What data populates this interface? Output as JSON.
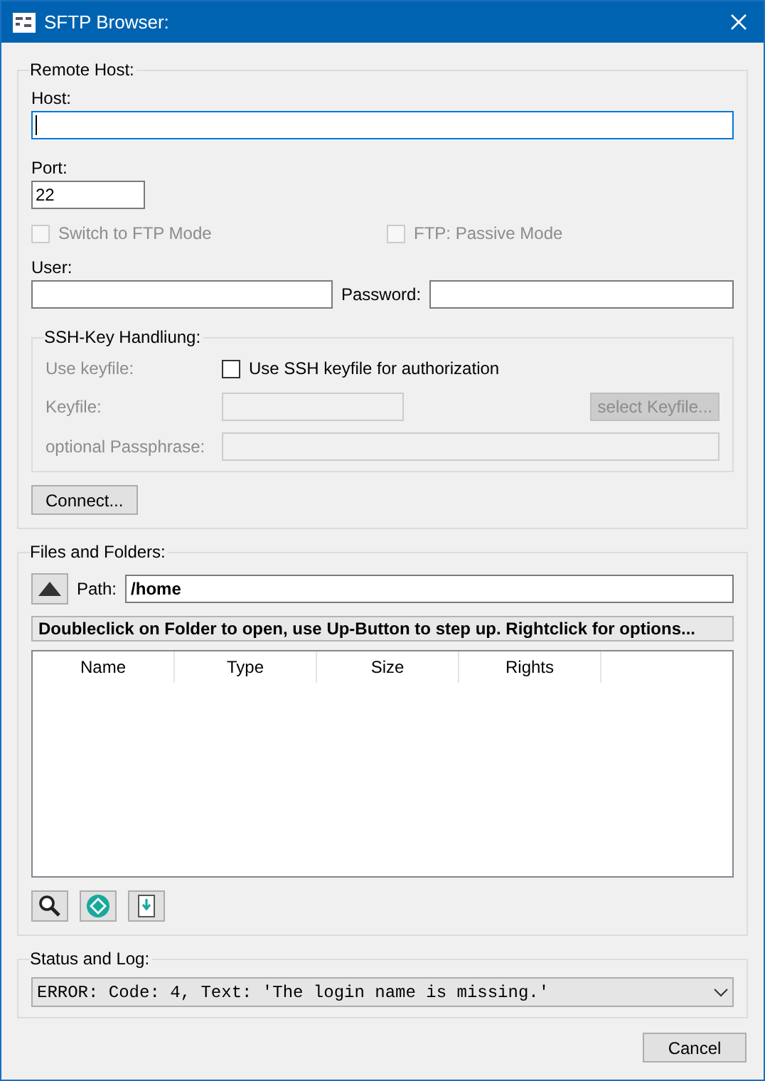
{
  "window": {
    "title": "SFTP Browser:"
  },
  "remote_host": {
    "title": "Remote Host:",
    "host": {
      "label": "Host:",
      "focused": true
    },
    "port": {
      "label": "Port:",
      "value": "22"
    },
    "ftp_mode": {
      "label": "Switch to FTP Mode",
      "checked": false,
      "disabled": true
    },
    "passive_mode": {
      "label": "FTP: Passive Mode",
      "checked": false,
      "disabled": true
    },
    "user": {
      "label": "User:"
    },
    "password": {
      "label": "Password:"
    },
    "ssh": {
      "title": "SSH-Key Handliung:",
      "use_keyfile_label": "Use keyfile:",
      "use_keyfile": {
        "label": "Use SSH keyfile for authorization",
        "checked": false
      },
      "keyfile_label": "Keyfile:",
      "select_button": "select Keyfile...",
      "passphrase_label": "optional Passphrase:",
      "disabled": true
    },
    "connect_button": "Connect..."
  },
  "files": {
    "title": "Files and Folders:",
    "path_label": "Path:",
    "path": "/home",
    "hint": "Doubleclick on Folder to open, use Up-Button to step up. Rightclick for options...",
    "columns": [
      "Name",
      "Type",
      "Size",
      "Rights"
    ]
  },
  "status": {
    "title": "Status and Log:",
    "log": "ERROR: Code: 4, Text: 'The login name is missing.'"
  },
  "cancel_button": "Cancel"
}
